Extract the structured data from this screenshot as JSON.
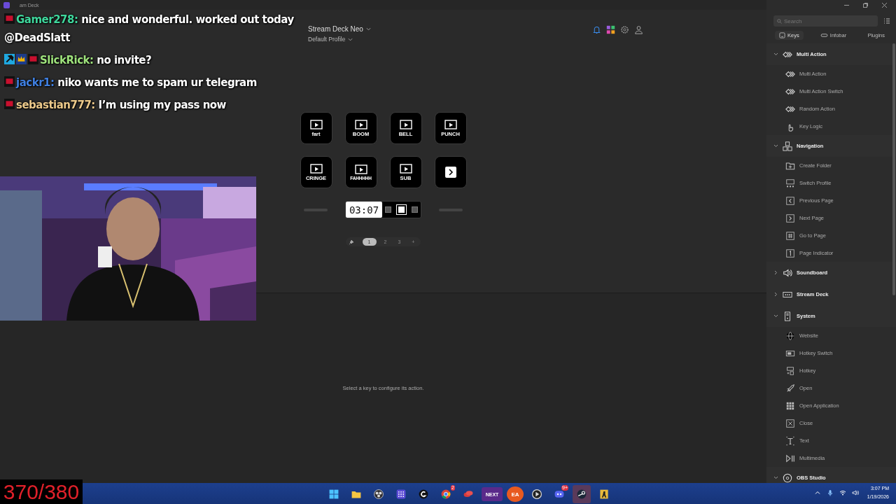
{
  "window": {
    "title": "am Deck"
  },
  "device": {
    "name": "Stream Deck Neo",
    "profile": "Default Profile"
  },
  "keys": [
    {
      "kind": "media",
      "label": "fart"
    },
    {
      "kind": "media",
      "label": "BOOM"
    },
    {
      "kind": "media",
      "label": "BELL"
    },
    {
      "kind": "media",
      "label": "PUNCH"
    },
    {
      "kind": "media",
      "label": "CRINGE"
    },
    {
      "kind": "media",
      "label": "FAHHHHH"
    },
    {
      "kind": "media",
      "label": "SUB"
    },
    {
      "kind": "next"
    }
  ],
  "infobar": {
    "clock": "03:07",
    "pages": [
      {
        "selected": false
      },
      {
        "selected": true
      },
      {
        "selected": false
      }
    ]
  },
  "page_tabs": {
    "pages": [
      {
        "label": "1",
        "selected": true
      },
      {
        "label": "2",
        "selected": false
      },
      {
        "label": "3",
        "selected": false
      }
    ],
    "add": "+"
  },
  "empty_message": "Select a key to configure its action.",
  "sidebar": {
    "search": {
      "placeholder": "Search"
    },
    "tabs": [
      {
        "label": "Keys",
        "selected": true
      },
      {
        "label": "Infobar",
        "selected": false
      },
      {
        "label": "Plugins",
        "selected": false
      }
    ],
    "categories": [
      {
        "name": "Multi Action",
        "expanded": true,
        "children": [
          {
            "name": "Multi Action"
          },
          {
            "name": "Multi Action Switch"
          },
          {
            "name": "Random Action"
          },
          {
            "name": "Key Logic"
          }
        ]
      },
      {
        "name": "Navigation",
        "expanded": true,
        "children": [
          {
            "name": "Create Folder"
          },
          {
            "name": "Switch Profile"
          },
          {
            "name": "Previous Page"
          },
          {
            "name": "Next Page"
          },
          {
            "name": "Go to Page"
          },
          {
            "name": "Page Indicator"
          }
        ]
      },
      {
        "name": "Soundboard",
        "expanded": false
      },
      {
        "name": "Stream Deck",
        "expanded": false
      },
      {
        "name": "System",
        "expanded": true,
        "children": [
          {
            "name": "Website"
          },
          {
            "name": "Hotkey Switch"
          },
          {
            "name": "Hotkey"
          },
          {
            "name": "Open"
          },
          {
            "name": "Open Application"
          },
          {
            "name": "Close"
          },
          {
            "name": "Text"
          },
          {
            "name": "Multimedia"
          }
        ]
      },
      {
        "name": "OBS Studio",
        "expanded": true
      }
    ]
  },
  "chat": [
    {
      "badges": [
        {
          "kind": "ebt"
        }
      ],
      "name": "Gamer278:",
      "color": "#3fd69c",
      "text": "nice and wonderful. worked out today @DeadSlatt"
    },
    {
      "badges": [
        {
          "kind": "mod"
        },
        {
          "kind": "crown"
        },
        {
          "kind": "ebt"
        }
      ],
      "name": "SlickRick:",
      "color": "#9ee27c",
      "text": "no invite?"
    },
    {
      "badges": [
        {
          "kind": "ebt"
        }
      ],
      "name": "jackr1:",
      "color": "#3f7fe0",
      "text": "niko wants me to spam ur telegram"
    },
    {
      "badges": [
        {
          "kind": "ebt"
        }
      ],
      "name": "sebastian777:",
      "color": "#ecc98a",
      "text": "I’m using my pass now"
    }
  ],
  "counter": "370/380",
  "taskbar": {
    "apps": [
      {
        "kind": "start"
      },
      {
        "kind": "folder"
      },
      {
        "kind": "obs"
      },
      {
        "kind": "grid"
      },
      {
        "kind": "g"
      },
      {
        "kind": "chrome",
        "badge": "2"
      },
      {
        "kind": "red"
      },
      {
        "kind": "text",
        "label": "NEXT"
      },
      {
        "kind": "ea",
        "label": "EA"
      },
      {
        "kind": "play"
      },
      {
        "kind": "discord",
        "badge": "9+"
      },
      {
        "kind": "steam",
        "selected": true
      },
      {
        "kind": "figure"
      }
    ],
    "time": "3:07 PM",
    "date": "1/19/2026"
  }
}
